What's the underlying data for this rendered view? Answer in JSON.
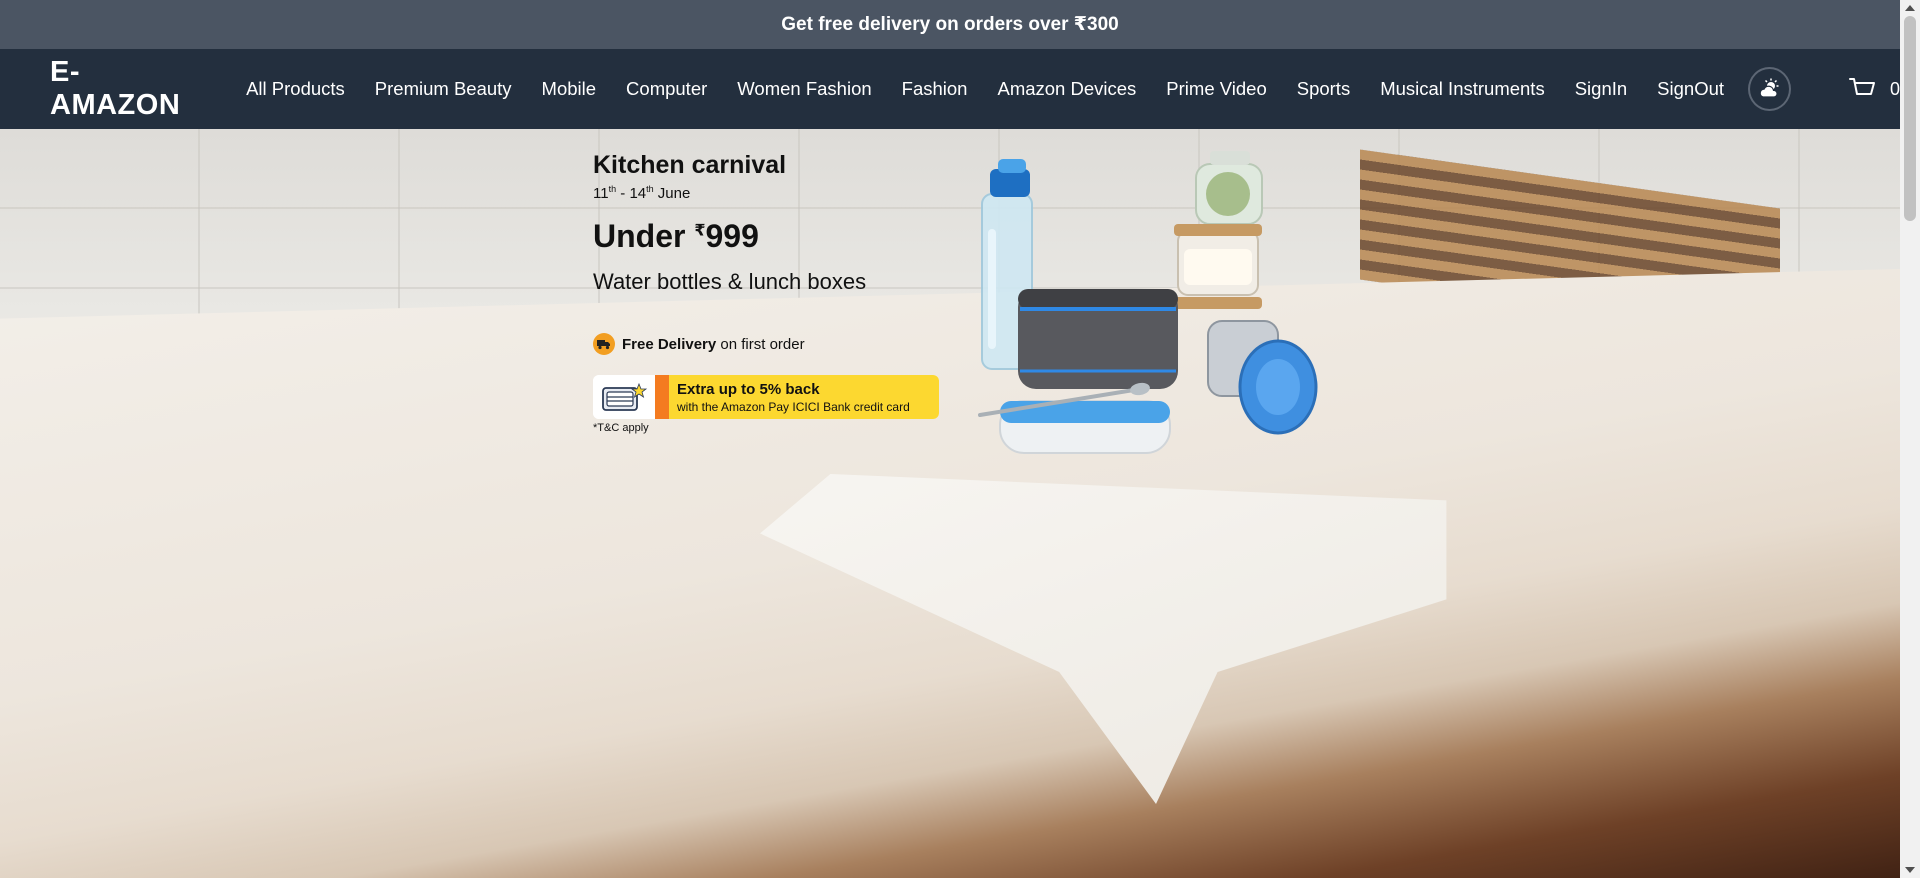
{
  "announcement": {
    "text": "Get free delivery on orders over ₹300"
  },
  "header": {
    "logo": "E-AMAZON",
    "nav_items": [
      {
        "label": "All Products",
        "name": "nav-all-products"
      },
      {
        "label": "Premium Beauty",
        "name": "nav-premium-beauty"
      },
      {
        "label": "Mobile",
        "name": "nav-mobile"
      },
      {
        "label": "Computer",
        "name": "nav-computer"
      },
      {
        "label": "Women Fashion",
        "name": "nav-women-fashion"
      },
      {
        "label": "Fashion",
        "name": "nav-fashion"
      },
      {
        "label": "Amazon Devices",
        "name": "nav-amazon-devices"
      },
      {
        "label": "Prime Video",
        "name": "nav-prime-video"
      },
      {
        "label": "Sports",
        "name": "nav-sports"
      },
      {
        "label": "Musical Instruments",
        "name": "nav-musical-instruments"
      },
      {
        "label": "SignIn",
        "name": "nav-signin"
      },
      {
        "label": "SignOut",
        "name": "nav-signout"
      }
    ],
    "theme_icon": "weather-theme-icon",
    "cart_icon": "cart-icon",
    "cart_count": "0"
  },
  "hero": {
    "title": "Kitchen carnival",
    "dates": {
      "start_day": "11",
      "start_suffix": "th",
      "separator": " - ",
      "end_day": "14",
      "end_suffix": "th",
      "month": " June"
    },
    "price": {
      "prefix": "Under ",
      "currency": "₹",
      "amount": "999"
    },
    "subtitle": "Water bottles & lunch boxes",
    "delivery": {
      "bold": "Free Delivery",
      "rest": " on first order"
    },
    "offer": {
      "title": "Extra up to 5% back",
      "description": "with the Amazon Pay ICICI Bank credit card"
    },
    "terms": "*T&C apply"
  },
  "colors": {
    "announcement_bg": "#4b5563",
    "navbar_bg": "#232f3e",
    "offer_yellow": "#fcd830",
    "offer_orange": "#f47b20",
    "delivery_orange": "#f29e21"
  }
}
